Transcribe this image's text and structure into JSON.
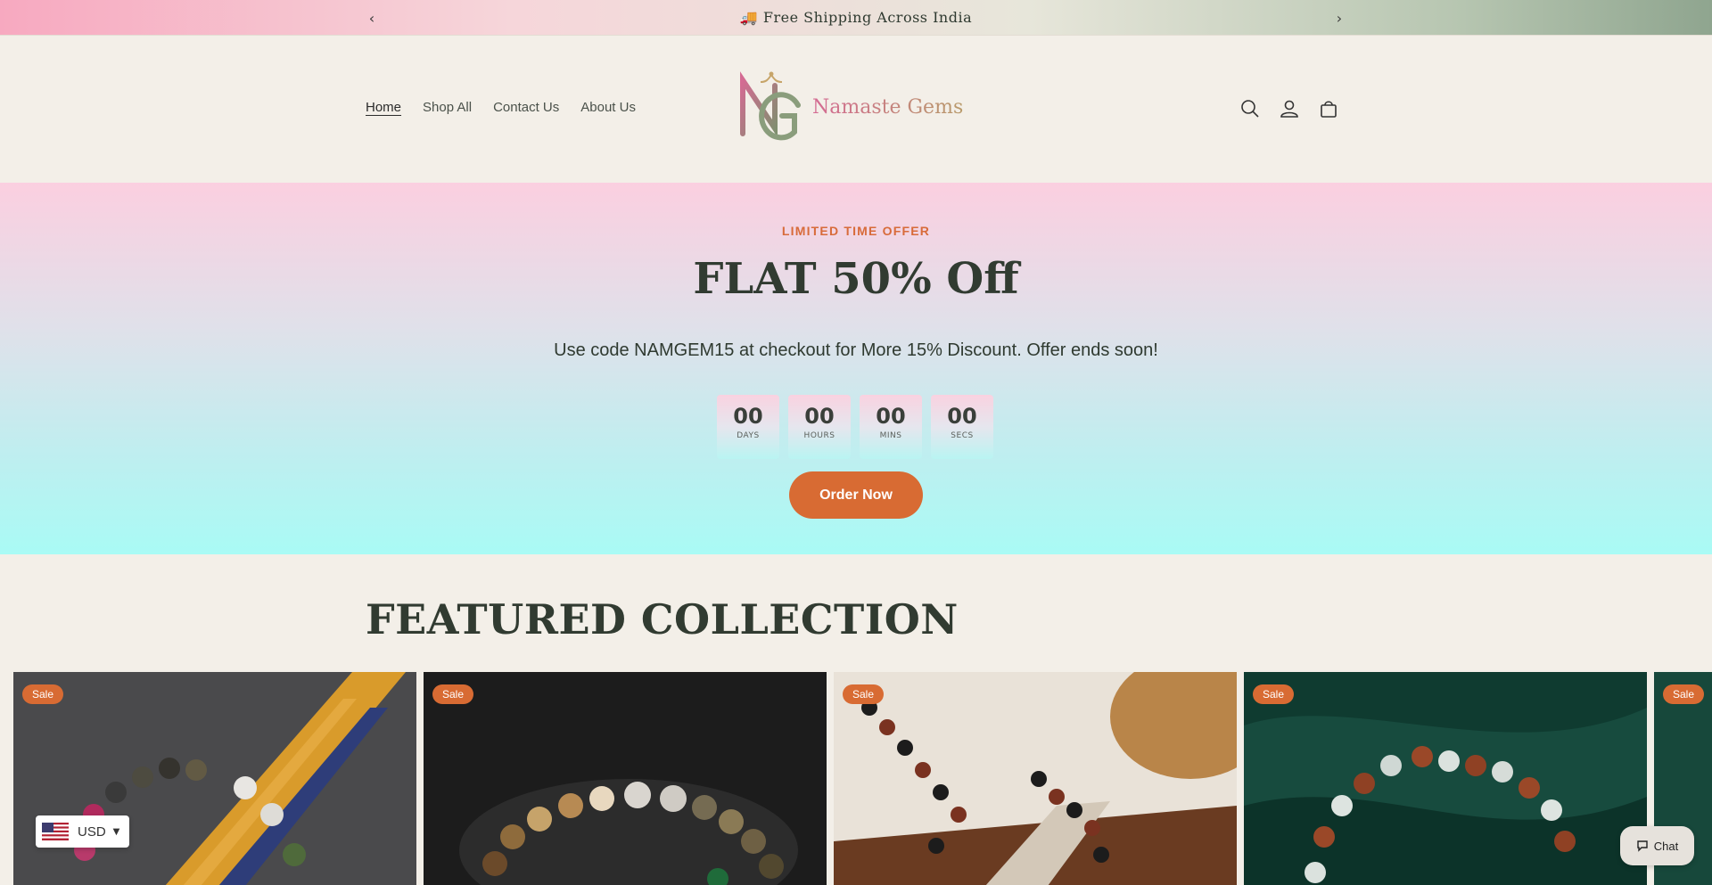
{
  "announcement": {
    "prev_label": "‹",
    "next_label": "›",
    "message": "🚚 Free Shipping Across India"
  },
  "header": {
    "nav": [
      {
        "label": "Home",
        "active": true
      },
      {
        "label": "Shop All"
      },
      {
        "label": "Contact Us"
      },
      {
        "label": "About Us"
      }
    ],
    "logo_text": "Namaste Gems",
    "icons": [
      "search-icon",
      "account-icon",
      "cart-icon"
    ]
  },
  "hero": {
    "eyebrow": "LIMITED TIME OFFER",
    "headline": "FLAT 50% Off",
    "subtext": "Use code NAMGEM15 at checkout for More 15% Discount. Offer ends soon!",
    "countdown": [
      {
        "value": "00",
        "label": "DAYS"
      },
      {
        "value": "00",
        "label": "HOURS"
      },
      {
        "value": "00",
        "label": "MINS"
      },
      {
        "value": "00",
        "label": "SECS"
      }
    ],
    "cta": "Order Now"
  },
  "featured": {
    "title": "FEATURED COLLECTION",
    "cards": [
      {
        "badge": "Sale"
      },
      {
        "badge": "Sale"
      },
      {
        "badge": "Sale"
      },
      {
        "badge": "Sale"
      },
      {
        "badge": "Sale"
      }
    ]
  },
  "currency": {
    "code": "USD"
  },
  "chat": {
    "label": "Chat"
  },
  "colors": {
    "accent": "#d86b33",
    "text": "#313b31",
    "background": "#f3efe8"
  }
}
